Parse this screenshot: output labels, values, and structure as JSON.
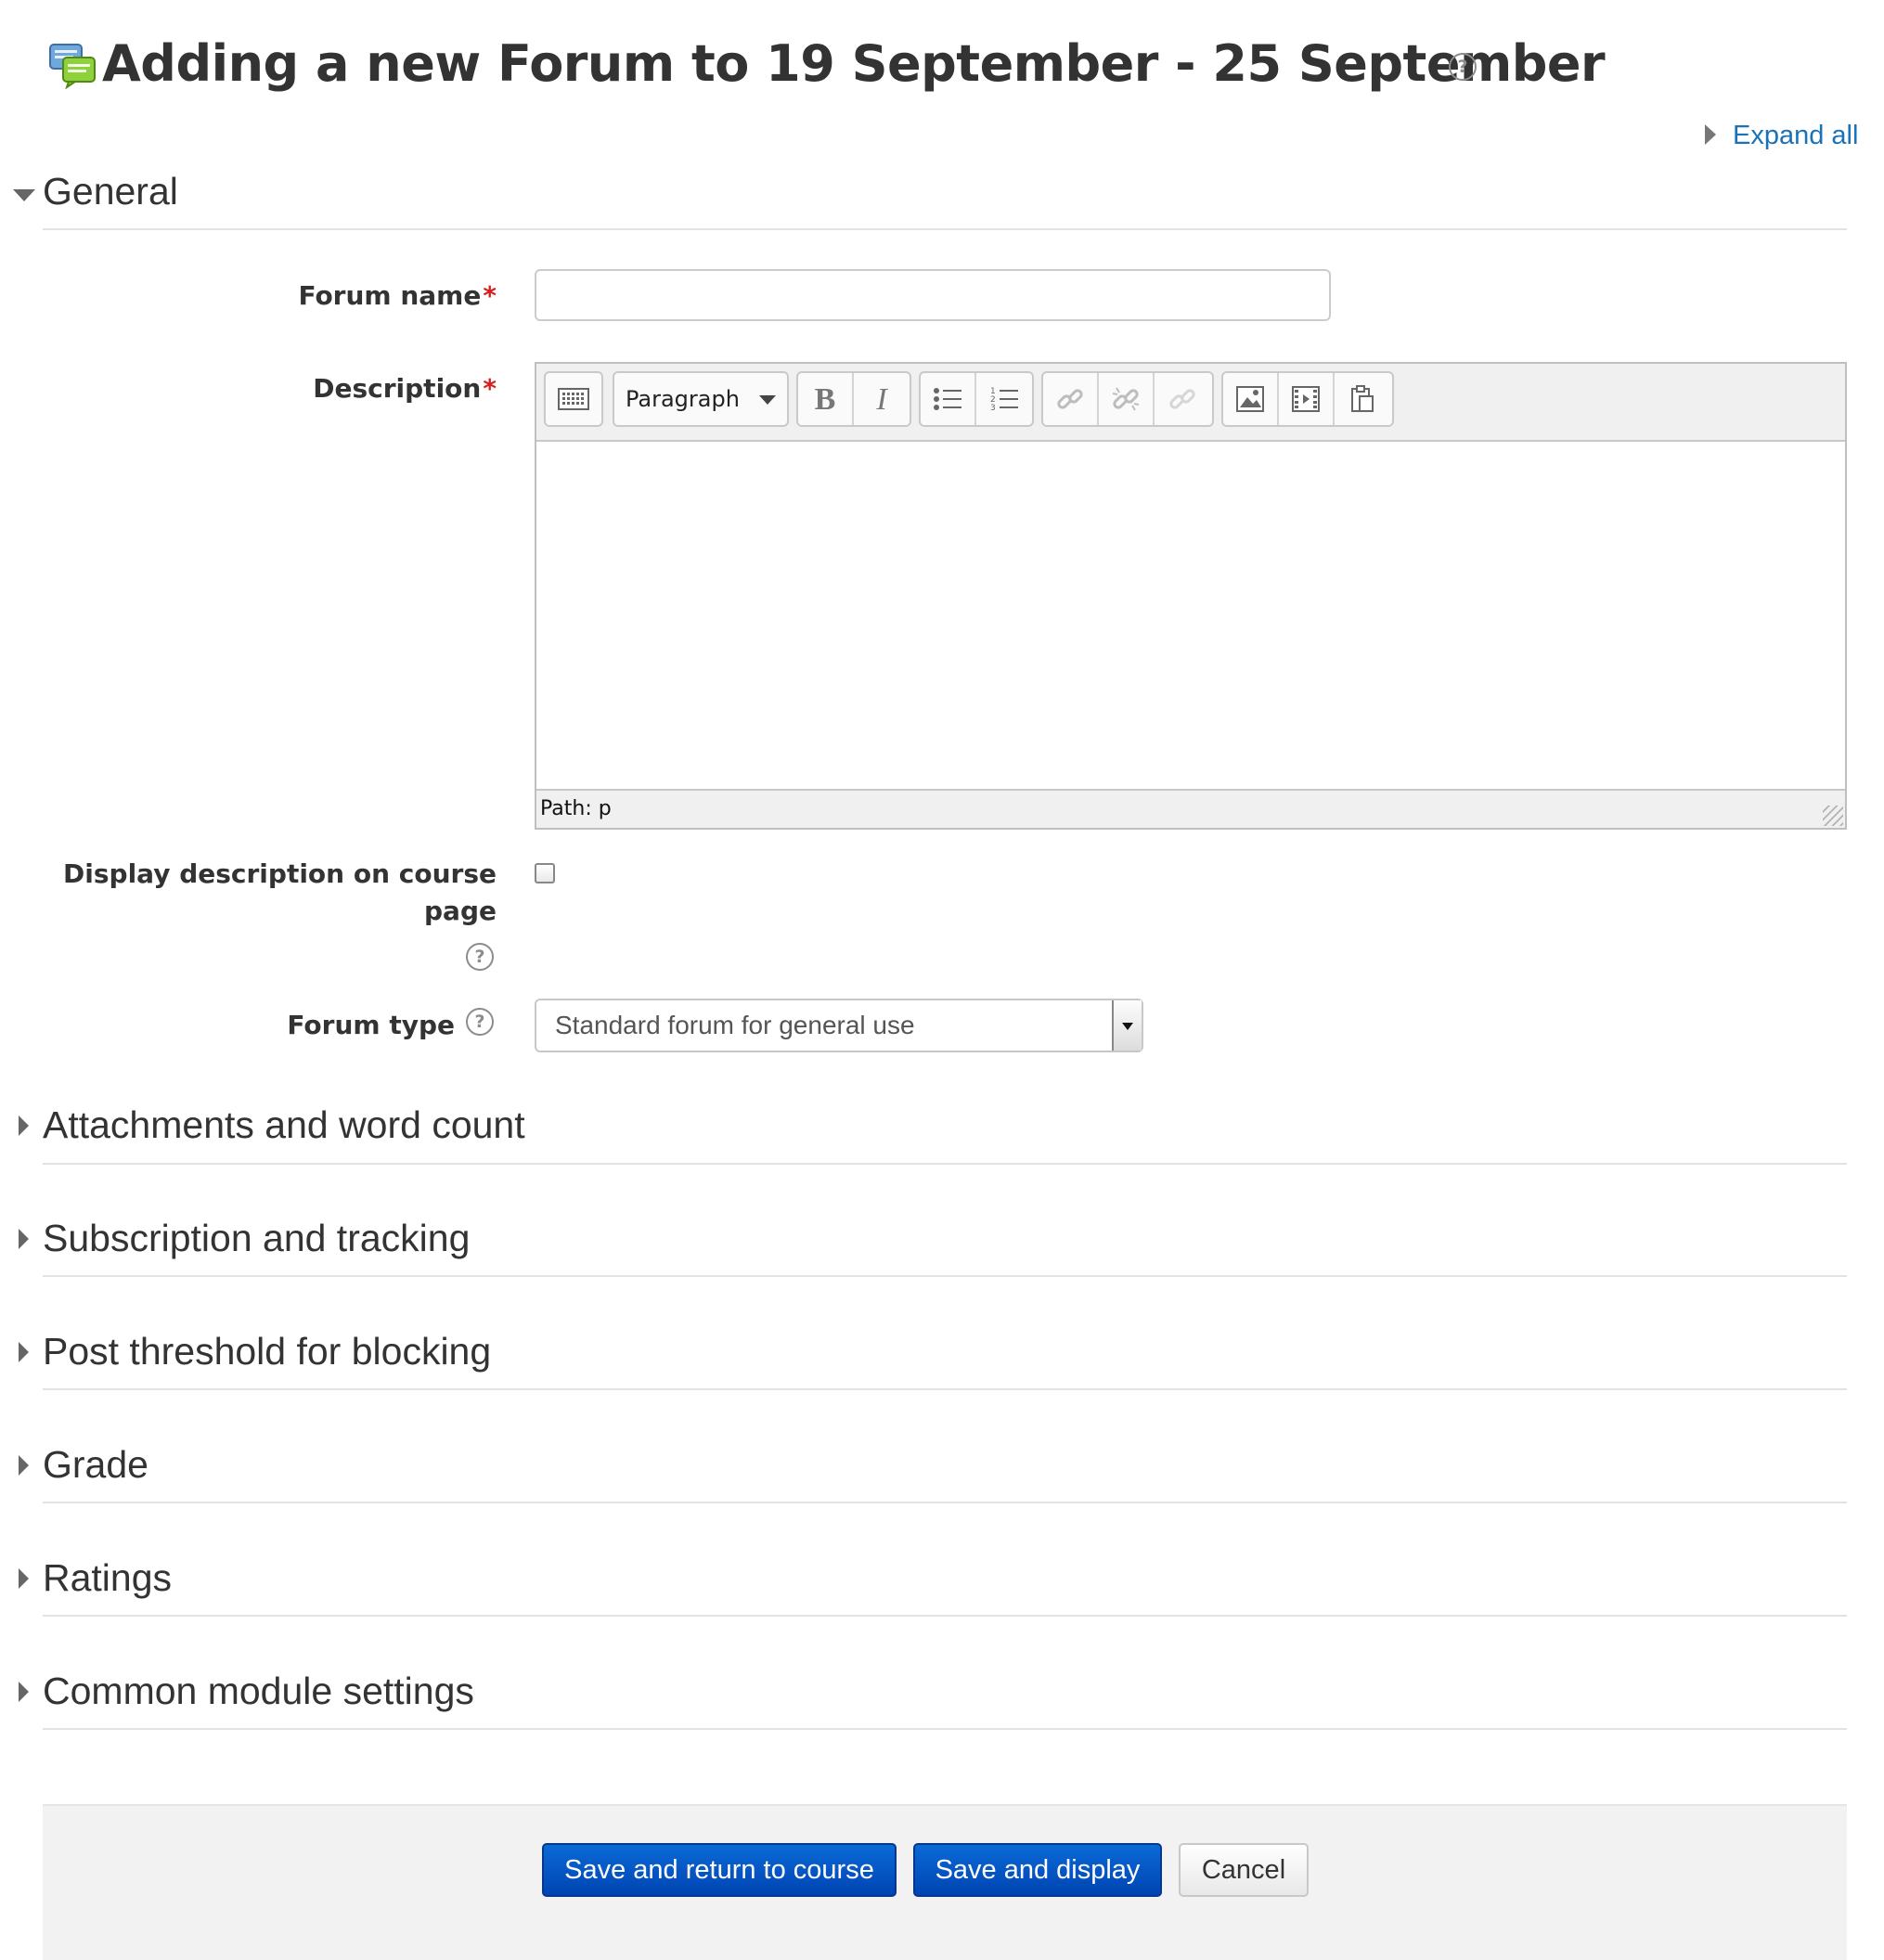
{
  "page": {
    "title": "Adding a new Forum to 19 September - 25 September",
    "expand_all": "Expand all"
  },
  "sections": {
    "general": "General",
    "attachments": "Attachments and word count",
    "subscription": "Subscription and tracking",
    "post_threshold": "Post threshold for blocking",
    "grade": "Grade",
    "ratings": "Ratings",
    "common_module": "Common module settings"
  },
  "form": {
    "forum_name_label": "Forum name",
    "forum_name_value": "",
    "description_label": "Description",
    "required_marker": "*",
    "editor": {
      "format_value": "Paragraph",
      "path": "Path: p"
    },
    "display_desc_label_line1": "Display description on course",
    "display_desc_label_line2": "page",
    "display_desc_checked": false,
    "forum_type_label": "Forum type",
    "forum_type_value": "Standard forum for general use"
  },
  "icons": {
    "help": "?"
  },
  "buttons": {
    "save_return": "Save and return to course",
    "save_display": "Save and display",
    "cancel": "Cancel"
  },
  "colors": {
    "link": "#1a73b8",
    "primary_button": "#0055c4",
    "required": "#d71d1d"
  }
}
